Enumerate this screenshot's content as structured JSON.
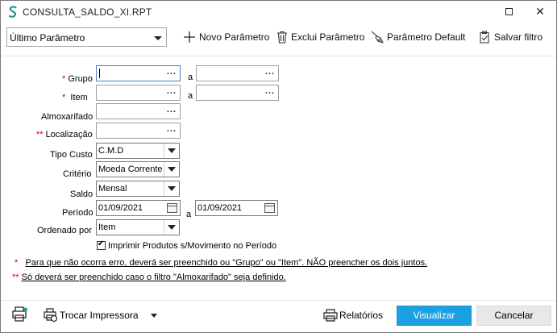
{
  "window": {
    "title": "CONSULTA_SALDO_XI.RPT",
    "app_icon": "s-logo-icon",
    "restore_icon": "restore-window-icon",
    "close_glyph": "✕"
  },
  "toolbar": {
    "parameter_select": "Último Parâmetro",
    "new_parameter": "Novo Parâmetro",
    "delete_parameter": "Exclui Parâmetro",
    "default_parameter": "Parâmetro Default",
    "save_filter": "Salvar filtro"
  },
  "form": {
    "grupo": {
      "label": "Grupo",
      "marker": "*",
      "from": "",
      "to": ""
    },
    "item": {
      "label": "Item",
      "marker": "*",
      "from": "",
      "to": ""
    },
    "almoxarifado": {
      "label": "Almoxarifado",
      "value": ""
    },
    "localizacao": {
      "label": "Localização",
      "marker": "**",
      "value": ""
    },
    "tipo_custo": {
      "label": "Tipo Custo",
      "value": "C.M.D"
    },
    "criterio": {
      "label": "Critério",
      "value": "Moeda Corrente"
    },
    "saldo": {
      "label": "Saldo",
      "value": "Mensal"
    },
    "periodo": {
      "label": "Período",
      "from": "01/09/2021",
      "to": "01/09/2021"
    },
    "ordenado_por": {
      "label": "Ordenado por",
      "value": "Item"
    },
    "range_separator": "a",
    "lookup_dots": "...",
    "print_no_movement": {
      "label": "Imprimir Produtos s/Movimento no Período",
      "checked": true
    }
  },
  "notes": [
    {
      "marker": "*",
      "text": "Para que não ocorra erro, deverá ser preenchido ou \"Grupo\" ou \"Item\". NÃO preencher os dois juntos."
    },
    {
      "marker": "**",
      "text": "Só deverá ser preenchido caso o filtro \"Almoxarifado\" seja definido."
    }
  ],
  "footer": {
    "change_printer": "Trocar Impressora",
    "reports": "Relatórios",
    "visualize": "Visualizar",
    "cancel": "Cancelar"
  },
  "colors": {
    "accent": "#1ba1e2",
    "required": "#d40000",
    "app_icon": "#1c9a8e"
  }
}
